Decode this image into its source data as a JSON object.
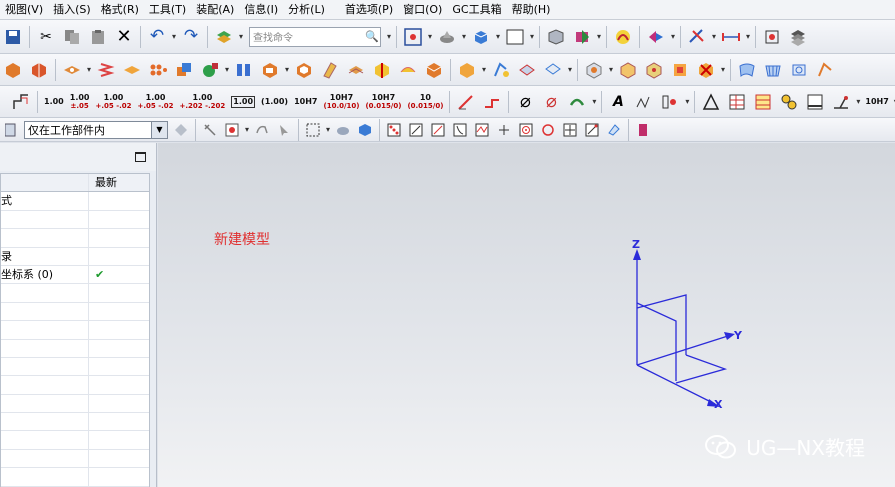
{
  "menu": [
    "视图(V)",
    "插入(S)",
    "格式(R)",
    "工具(T)",
    "装配(A)",
    "信息(I)",
    "分析(L)",
    "首选项(P)",
    "窗口(O)",
    "GC工具箱",
    "帮助(H)"
  ],
  "command_search": {
    "placeholder": "查找命令"
  },
  "dims": [
    {
      "main": "1.00",
      "tol": ""
    },
    {
      "main": "1.00",
      "tol": "±.05"
    },
    {
      "main": "1.00",
      "tol": "+.05 -.02"
    },
    {
      "main": "1.00",
      "tol": "+.05 -.02"
    },
    {
      "main": "1.00",
      "tol": "+.202 -.202"
    },
    {
      "main": "1.00",
      "tol": ""
    },
    {
      "main": "(1.00)",
      "tol": ""
    },
    {
      "main": "10H7",
      "tol": ""
    },
    {
      "main": "10H7",
      "tol": "(10.0/10)"
    },
    {
      "main": "10H7",
      "tol": "(0.015/0)"
    },
    {
      "main": "10",
      "tol": "(0.015/0)"
    }
  ],
  "dim_end": "10H7",
  "selection_filter": {
    "value": "仅在工作部件内"
  },
  "navigator": {
    "columns": [
      "",
      "最新"
    ],
    "rows": [
      {
        "name": "式",
        "latest": ""
      },
      {
        "name": "",
        "latest": ""
      },
      {
        "name": "",
        "latest": ""
      },
      {
        "name": "录",
        "latest": ""
      },
      {
        "name": "坐标系 (0)",
        "latest": "✔"
      },
      {
        "name": "",
        "latest": ""
      },
      {
        "name": "",
        "latest": ""
      },
      {
        "name": "",
        "latest": ""
      },
      {
        "name": "",
        "latest": ""
      },
      {
        "name": "",
        "latest": ""
      },
      {
        "name": "",
        "latest": ""
      },
      {
        "name": "",
        "latest": ""
      },
      {
        "name": "",
        "latest": ""
      },
      {
        "name": "",
        "latest": ""
      },
      {
        "name": "",
        "latest": ""
      },
      {
        "name": "",
        "latest": ""
      },
      {
        "name": "",
        "latest": ""
      }
    ]
  },
  "viewport": {
    "model_label": "新建模型",
    "axis_x": "X",
    "axis_y": "Y",
    "axis_z": "Z",
    "watermark": "UG—NX教程"
  },
  "colors": {
    "triad": "#2b2bd9",
    "model_label": "#e03030",
    "check": "#1c9a2c"
  }
}
